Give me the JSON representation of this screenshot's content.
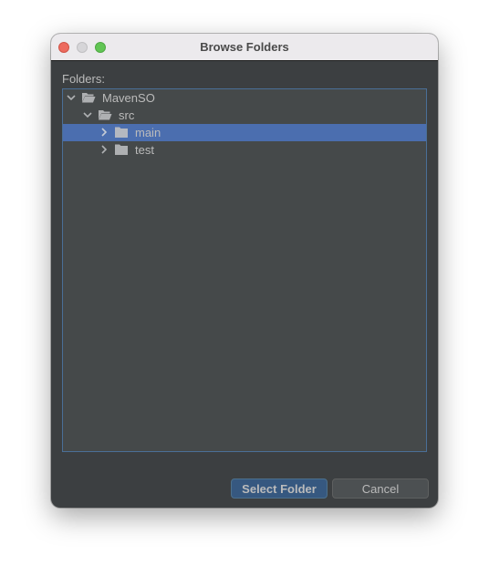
{
  "window": {
    "title": "Browse Folders",
    "controls": [
      "close",
      "minimize",
      "zoom"
    ]
  },
  "folders_label": "Folders:",
  "tree": [
    {
      "name": "MavenSO",
      "level": 0,
      "expanded": true,
      "selected": false,
      "icon": "folder-open-icon"
    },
    {
      "name": "src",
      "level": 1,
      "expanded": true,
      "selected": false,
      "icon": "folder-open-icon"
    },
    {
      "name": "main",
      "level": 2,
      "expanded": false,
      "selected": true,
      "icon": "folder-icon"
    },
    {
      "name": "test",
      "level": 2,
      "expanded": false,
      "selected": false,
      "icon": "folder-icon"
    }
  ],
  "buttons": {
    "select": "Select Folder",
    "cancel": "Cancel"
  },
  "colors": {
    "selection": "#4b6eaf",
    "primary_button": "#365880",
    "dialog_bg": "#3c3f41",
    "tree_bg": "#45494a"
  }
}
